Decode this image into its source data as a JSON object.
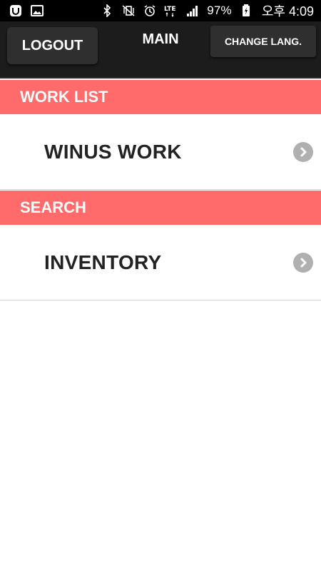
{
  "status_bar": {
    "battery": "97%",
    "time": "오후 4:09",
    "network": "LTE"
  },
  "header": {
    "logout_label": "LOGOUT",
    "title": "MAIN",
    "change_lang_label": "CHANGE LANG."
  },
  "sections": [
    {
      "title": "WORK LIST",
      "items": [
        {
          "label": "WINUS WORK",
          "icon": "chevron-right-icon"
        }
      ]
    },
    {
      "title": "SEARCH",
      "items": [
        {
          "label": "INVENTORY",
          "icon": "chevron-right-icon"
        }
      ]
    }
  ],
  "colors": {
    "section_header": "#ff6b6b",
    "header_bg": "#1c1c1c",
    "button_bg": "#2f2f2f",
    "chevron_bg": "#b0b0b0"
  }
}
